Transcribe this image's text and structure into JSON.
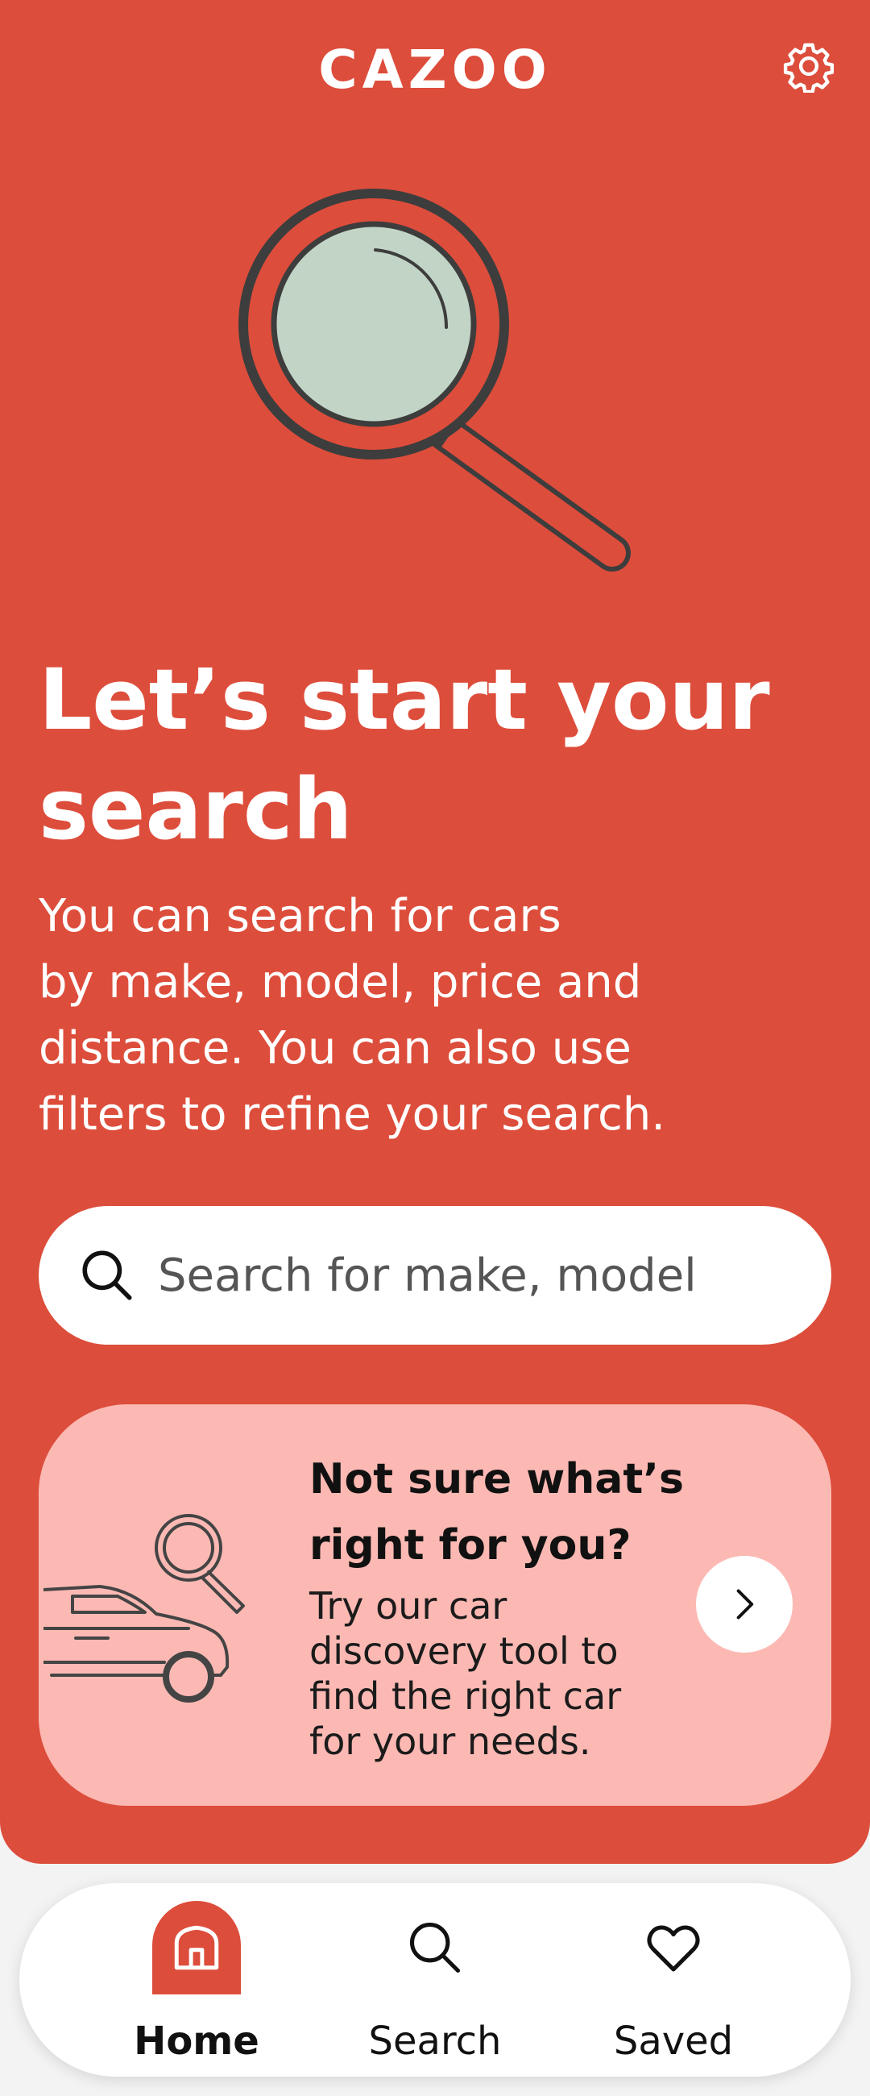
{
  "header": {
    "logo_text": "CAZOO",
    "settings_icon": "gear-icon"
  },
  "hero": {
    "illustration": "magnifying-glass-illustration",
    "headline": "Let’s start your search",
    "subtext": "You can search for cars\nby make, model, price and\ndistance. You can also use\nfilters to refine your search."
  },
  "search": {
    "icon": "search-icon",
    "placeholder": "Search for make, model"
  },
  "discovery_card": {
    "title": "Not sure what’s right for you?",
    "body": "Try our car\ndiscovery tool to\nfind the right car\nfor your needs.",
    "illustration": "car-magnifier-illustration",
    "arrow_icon": "chevron-right-icon"
  },
  "bottom_nav": {
    "items": [
      {
        "label": "Home",
        "icon": "home-icon",
        "active": true
      },
      {
        "label": "Search",
        "icon": "search-icon",
        "active": false
      },
      {
        "label": "Saved",
        "icon": "heart-icon",
        "active": false
      }
    ]
  },
  "colors": {
    "brand_red": "#dd4d3b",
    "card_pink": "#fcb9b3",
    "lens_green": "#c1d4c6"
  }
}
